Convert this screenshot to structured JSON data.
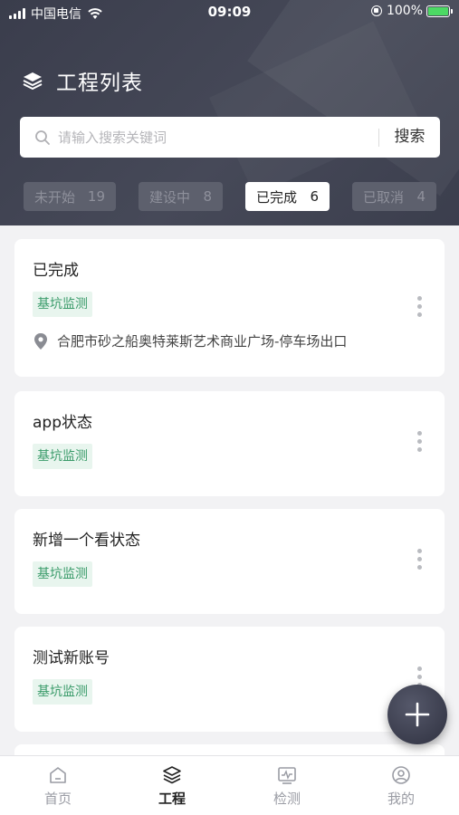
{
  "status_bar": {
    "carrier": "中国电信",
    "time": "09:09",
    "battery": "100%"
  },
  "header": {
    "title": "工程列表"
  },
  "search": {
    "placeholder": "请输入搜索关键词",
    "button_label": "搜索"
  },
  "tabs": [
    {
      "label": "未开始",
      "count": "19"
    },
    {
      "label": "建设中",
      "count": "8"
    },
    {
      "label": "已完成",
      "count": "6"
    },
    {
      "label": "已取消",
      "count": "4"
    }
  ],
  "active_tab": "已完成",
  "projects": [
    {
      "name": "已完成",
      "tag": "基坑监测",
      "location": "合肥市砂之船奥特莱斯艺术商业广场-停车场出口"
    },
    {
      "name": "app状态",
      "tag": "基坑监测"
    },
    {
      "name": "新增一个看状态",
      "tag": "基坑监测"
    },
    {
      "name": "测试新账号",
      "tag": "基坑监测"
    }
  ],
  "bottom_nav": [
    {
      "label": "首页",
      "icon": "home-icon"
    },
    {
      "label": "工程",
      "icon": "layers-icon"
    },
    {
      "label": "检测",
      "icon": "monitor-icon"
    },
    {
      "label": "我的",
      "icon": "user-icon"
    }
  ],
  "active_nav": "工程",
  "colors": {
    "header_bg": "#3f4250",
    "tag_bg": "#e8f5ee",
    "tag_text": "#3a9b6a",
    "battery_fill": "#4cd964"
  }
}
